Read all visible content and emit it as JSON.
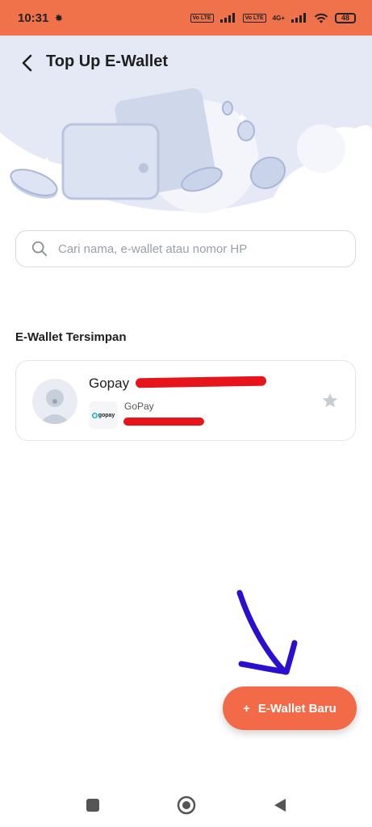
{
  "status_bar": {
    "time": "10:31",
    "battery": "48",
    "signal_badges": [
      "Vo LTE",
      "Vo LTE"
    ],
    "network": "4G+"
  },
  "header": {
    "title": "Top Up E-Wallet",
    "back_icon": "chevron-left-icon"
  },
  "search": {
    "placeholder": "Cari nama, e-wallet atau nomor HP",
    "value": ""
  },
  "saved_section": {
    "title": "E-Wallet Tersimpan",
    "items": [
      {
        "name": "Gopay",
        "provider": "GoPay",
        "logo_text": "gopay",
        "favorite_icon": "star-icon"
      }
    ]
  },
  "fab": {
    "icon": "+",
    "label": "E-Wallet Baru"
  },
  "colors": {
    "accent": "#f26a47",
    "status_bar": "#f0724b",
    "hero_bg": "#e4e9f5",
    "redaction": "#e8141c",
    "annotation_arrow": "#2a0fd0"
  }
}
